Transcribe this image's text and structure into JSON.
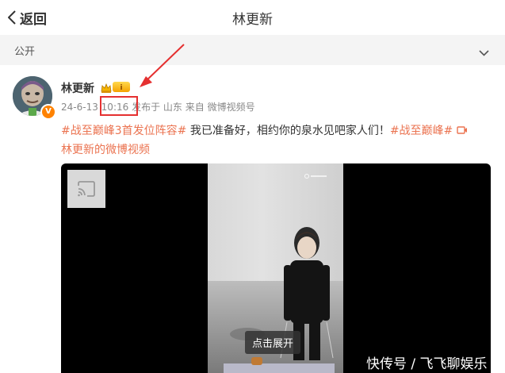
{
  "nav": {
    "back_label": "返回",
    "title": "林更新"
  },
  "visibility": {
    "label": "公开"
  },
  "post": {
    "username": "林更新",
    "date": "24-6-13",
    "time": "10:16",
    "published_in": "发布于 山东",
    "source": "来自 微博视频号",
    "text_tag1": "#战至巅峰3首发位阵容#",
    "text_body": " 我已准备好，相约你的泉水见吧家人们！",
    "text_tag2": "#战至巅峰#",
    "video_link_label": "林更新的微博视频"
  },
  "video": {
    "expand_label": "点击展开"
  },
  "watermark": "快传号 / 飞飞聊娱乐",
  "colors": {
    "tag": "#eb7350",
    "annotation_red": "#e53030",
    "badge_orange": "#ff8200"
  }
}
